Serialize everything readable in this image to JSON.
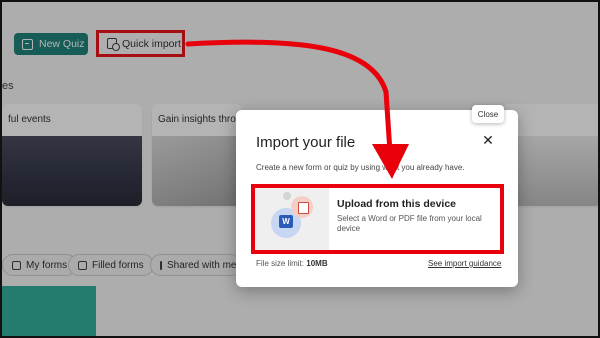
{
  "toolbar": {
    "new_quiz_label": "New Quiz",
    "quick_import_label": "Quick import"
  },
  "section": {
    "label": "es"
  },
  "cards": [
    {
      "title": "ful events"
    },
    {
      "title": "Gain insights throu"
    },
    {
      "title": ""
    }
  ],
  "chips": [
    {
      "label": "My forms"
    },
    {
      "label": "Filled forms"
    },
    {
      "label": "Shared with me"
    }
  ],
  "dialog": {
    "title": "Import your file",
    "close_tooltip": "Close",
    "close_icon": "close-icon",
    "description": "Create a new form or quiz by using what you already have.",
    "upload": {
      "title": "Upload from this device",
      "subtitle": "Select a Word or PDF file from your local device",
      "word_badge": "W"
    },
    "file_size_label": "File size limit:",
    "file_size_value": "10MB",
    "guidance_link": "See import guidance"
  },
  "colors": {
    "accent": "#0d7a72",
    "annotation": "#e8000b"
  }
}
